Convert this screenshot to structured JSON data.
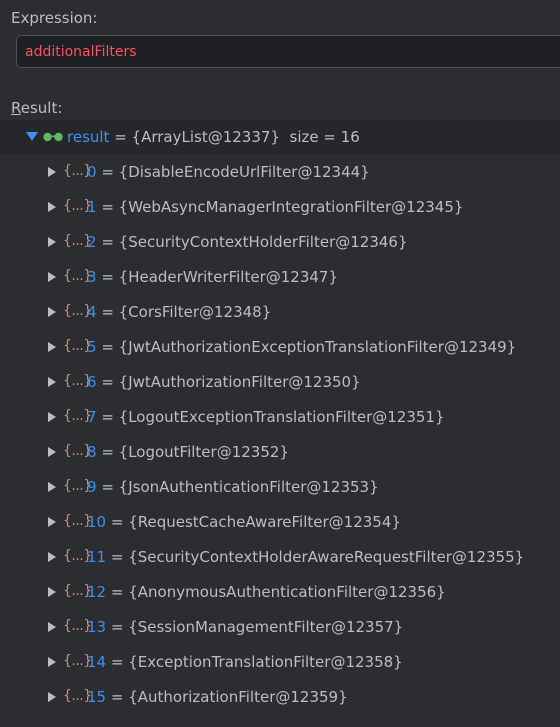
{
  "expression": {
    "label": "Expression:",
    "value": "additionalFilters"
  },
  "result": {
    "label_mnemonic": "R",
    "label_rest": "esult:",
    "root": {
      "name": "result",
      "equals": " = ",
      "value": "{ArrayList@12337}",
      "size": "size = 16",
      "expanded": true
    },
    "items": [
      {
        "index": "0",
        "value": "{DisableEncodeUrlFilter@12344}"
      },
      {
        "index": "1",
        "value": "{WebAsyncManagerIntegrationFilter@12345}"
      },
      {
        "index": "2",
        "value": "{SecurityContextHolderFilter@12346}"
      },
      {
        "index": "3",
        "value": "{HeaderWriterFilter@12347}"
      },
      {
        "index": "4",
        "value": "{CorsFilter@12348}"
      },
      {
        "index": "5",
        "value": "{JwtAuthorizationExceptionTranslationFilter@12349}"
      },
      {
        "index": "6",
        "value": "{JwtAuthorizationFilter@12350}"
      },
      {
        "index": "7",
        "value": "{LogoutExceptionTranslationFilter@12351}"
      },
      {
        "index": "8",
        "value": "{LogoutFilter@12352}"
      },
      {
        "index": "9",
        "value": "{JsonAuthenticationFilter@12353}"
      },
      {
        "index": "10",
        "value": "{RequestCacheAwareFilter@12354}"
      },
      {
        "index": "11",
        "value": "{SecurityContextHolderAwareRequestFilter@12355}"
      },
      {
        "index": "12",
        "value": "{AnonymousAuthenticationFilter@12356}"
      },
      {
        "index": "13",
        "value": "{SessionManagementFilter@12357}"
      },
      {
        "index": "14",
        "value": "{ExceptionTranslationFilter@12358}"
      },
      {
        "index": "15",
        "value": "{AuthorizationFilter@12359}"
      }
    ]
  },
  "icons": {
    "root_toggle": "chevron-down-icon",
    "root_watch": "glasses-icon",
    "item_toggle": "chevron-right-icon",
    "item_type": "object-braces-icon",
    "item_type_glyph": "{...}"
  },
  "colors": {
    "background": "#2b2d30",
    "expression_text": "#f75464",
    "name_blue": "#3d8ff0",
    "brace_orange": "#cf8e6d"
  }
}
